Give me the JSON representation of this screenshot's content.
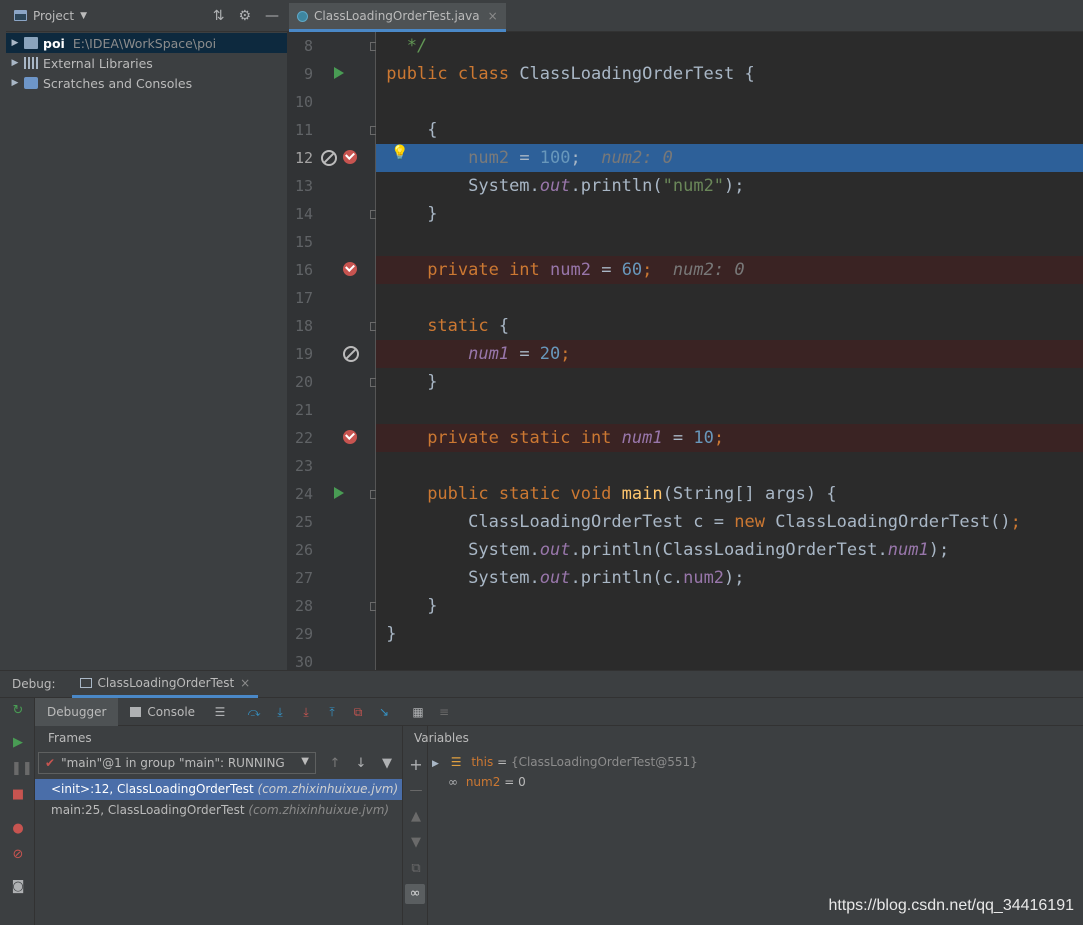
{
  "project": {
    "title": "Project",
    "tree": [
      {
        "name": "poi",
        "path": "E:\\IDEA\\WorkSpace\\poi",
        "icon": "module-folder-icon",
        "selected": true
      },
      {
        "name": "External Libraries",
        "icon": "library-icon"
      },
      {
        "name": "Scratches and Consoles",
        "icon": "scratch-icon"
      }
    ]
  },
  "editor": {
    "tab_label": "ClassLoadingOrderTest.java",
    "tab_close": "×",
    "line_numbers": [
      "8",
      "9",
      "10",
      "11",
      "12",
      "13",
      "14",
      "15",
      "16",
      "17",
      "18",
      "19",
      "20",
      "21",
      "22",
      "23",
      "24",
      "25",
      "26",
      "27",
      "28",
      "29",
      "30"
    ]
  },
  "code": {
    "l8": "*/",
    "l9a": "public class ",
    "l9b": "ClassLoadingOrderTest {",
    "l11": "{",
    "l12a": "num2",
    "l12b": " = ",
    "l12c": "100",
    "l12d": ";",
    "l12hint": "num2: 0",
    "l13a": "System.",
    "l13b": "out",
    "l13c": ".println(",
    "l13d": "\"num2\"",
    "l13e": ");",
    "l14": "}",
    "l16a": "private int ",
    "l16b": "num2",
    "l16c": " = ",
    "l16d": "60",
    "l16e": ";",
    "l16hint": "num2: 0",
    "l18a": "static",
    "l18b": " {",
    "l19a": "num1",
    "l19b": " = ",
    "l19c": "20",
    "l19d": ";",
    "l20": "}",
    "l22a": "private static int ",
    "l22b": "num1",
    "l22c": " = ",
    "l22d": "10",
    "l22e": ";",
    "l24a": "public static void ",
    "l24b": "main",
    "l24c": "(String[] args) {",
    "l25a": "ClassLoadingOrderTest c = ",
    "l25b": "new",
    "l25c": " ClassLoadingOrderTest()",
    "l25d": ";",
    "l26a": "System.",
    "l26b": "out",
    "l26c": ".println(ClassLoadingOrderTest.",
    "l26d": "num1",
    "l26e": ");",
    "l27a": "System.",
    "l27b": "out",
    "l27c": ".println(c.",
    "l27d": "num2",
    "l27e": ");",
    "l28": "}",
    "l29": "}"
  },
  "debug": {
    "label": "Debug:",
    "config_tab": "ClassLoadingOrderTest",
    "tab_close": "×",
    "tabs": [
      "Debugger",
      "Console"
    ],
    "frames_header": "Frames",
    "thread_select": "\"main\"@1 in group \"main\": RUNNING",
    "frames": [
      {
        "method": "<init>:12, ClassLoadingOrderTest",
        "pkg": "(com.zhixinhuixue.jvm)",
        "selected": true
      },
      {
        "method": "main:25, ClassLoadingOrderTest",
        "pkg": "(com.zhixinhuixue.jvm)",
        "selected": false
      }
    ],
    "variables_header": "Variables",
    "variables": [
      {
        "name": "this",
        "eq": " = ",
        "value": "{ClassLoadingOrderTest@551}"
      },
      {
        "name": "num2",
        "eq": " = ",
        "value": "0"
      }
    ]
  },
  "watermark": "https://blog.csdn.net/qq_34416191",
  "colors": {
    "accent": "#4a88c7",
    "breakpoint": "#c75450",
    "run": "#499c54",
    "current_line": "#2d6099"
  }
}
